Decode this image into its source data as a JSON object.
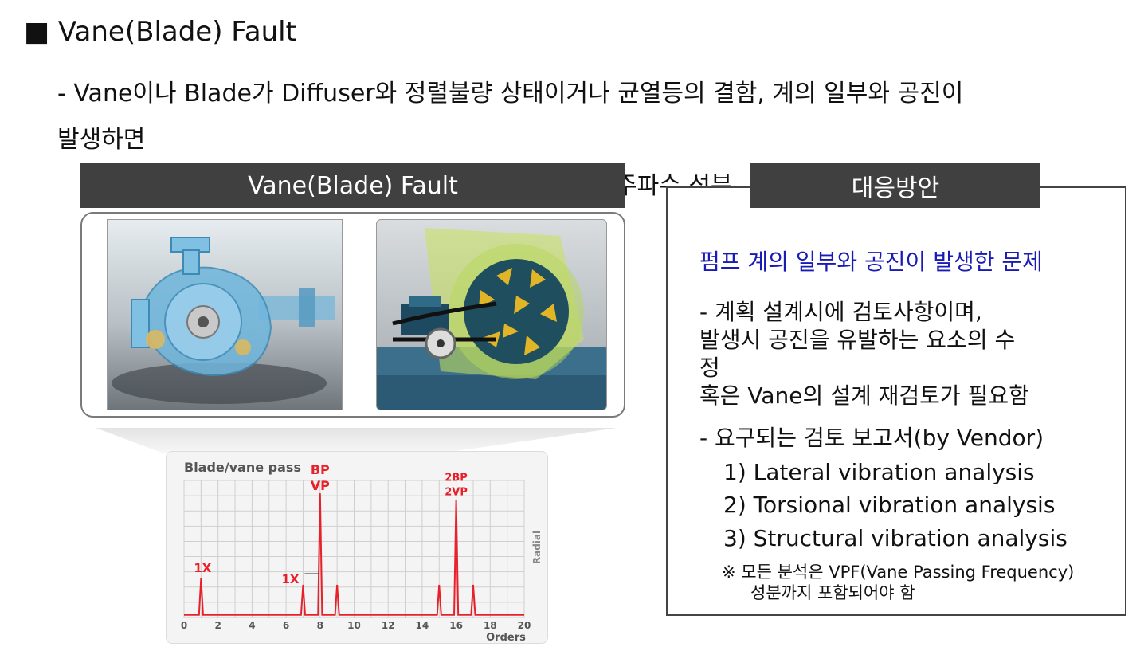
{
  "slide": {
    "title": "■ Vane(Blade) Fault",
    "bullet_line1": "- Vane이나 Blade가 Diffuser와 정렬불량 상태이거나 균열등의 결함, 계의 일부와 공진이",
    "bullet_line2": "발생하면",
    "bullet_line3_tail": "주파수 성분"
  },
  "left_panel": {
    "header": "Vane(Blade) Fault"
  },
  "chart_data": {
    "type": "line",
    "title": "Blade/vane pass",
    "xlabel": "Orders",
    "ylabel": "Radial",
    "xlim": [
      0,
      20
    ],
    "x_ticks": [
      "0",
      "2",
      "4",
      "6",
      "8",
      "10",
      "12",
      "14",
      "16",
      "18",
      "20"
    ],
    "grid": true,
    "peaks": [
      {
        "x": 1,
        "y": 0.3
      },
      {
        "x": 7,
        "y": 0.25
      },
      {
        "x": 8,
        "y": 0.95
      },
      {
        "x": 9,
        "y": 0.25
      },
      {
        "x": 15,
        "y": 0.25
      },
      {
        "x": 16,
        "y": 0.9
      },
      {
        "x": 17,
        "y": 0.25
      }
    ],
    "annotations": [
      {
        "x": 1,
        "text": "1X"
      },
      {
        "x": 7,
        "text": "1X"
      },
      {
        "x": 8,
        "text": "BP"
      },
      {
        "x": 8,
        "text": "VP"
      },
      {
        "x": 16,
        "text": "2BP"
      },
      {
        "x": 16,
        "text": "2VP"
      }
    ],
    "colors": {
      "line": "#e8202a",
      "label": "#e8202a"
    }
  },
  "right_panel": {
    "header": "대응방안",
    "problem_title": "펌프 계의 일부와 공진이 발생한 문제",
    "lines": [
      " - 계획 설계시에 검토사항이며,",
      "    발생시 공진을 유발하는 요소의 수",
      "정",
      "     혹은 Vane의 설계 재검토가 필요함",
      " - 요구되는 검토 보고서(by Vendor)",
      "1) Lateral vibration analysis",
      "2) Torsional vibration analysis",
      "3) Structural vibration analysis",
      "※ 모든 분석은 VPF(Vane Passing Frequency)",
      "성분까지 포함되어야 함"
    ],
    "problem_color": "#1a1ab4"
  }
}
